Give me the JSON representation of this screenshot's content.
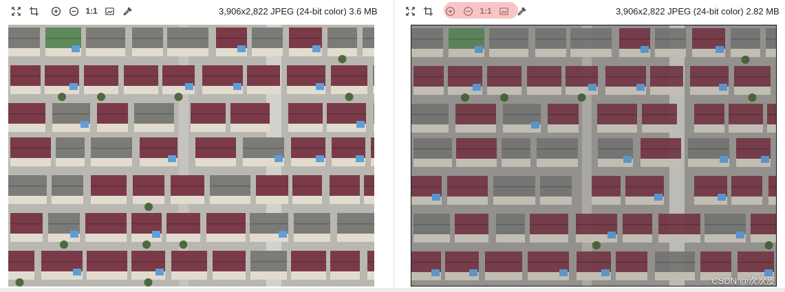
{
  "toolbar": {
    "zoom_label": "1:1",
    "tools": [
      "fit-icon",
      "crop-icon",
      "zoom-in-icon",
      "zoom-out-icon",
      "actual-size-icon",
      "screenshot-icon",
      "eyedropper-icon"
    ]
  },
  "left_image": {
    "info": "3,906x2,822 JPEG (24-bit color) 3.6 MB"
  },
  "right_image": {
    "info": "3,906x2,822 JPEG (24-bit color) 2.82 MB"
  },
  "watermark": "CSDN @次次皮",
  "colors": {
    "roof_red": "#7a3a48",
    "roof_green": "#5d8a5a",
    "roof_blue": "#5f9fd8",
    "roof_gray": "#7b7b78",
    "road": "#b9b7b1",
    "frame": "#111111",
    "badge": "#f29a9a"
  }
}
